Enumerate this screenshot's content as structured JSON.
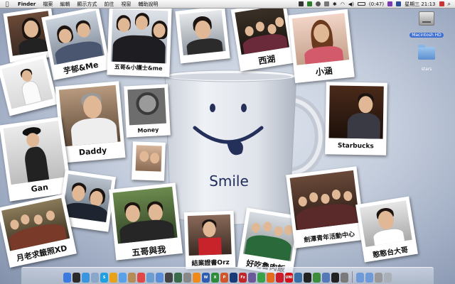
{
  "menubar": {
    "app": "Finder",
    "menus": [
      "檔案",
      "編輯",
      "顯示方式",
      "前往",
      "視窗",
      "輔助說明"
    ],
    "battery": "(0:47)",
    "clock": "星期三 21:13"
  },
  "desktop_icons": [
    {
      "label": "Macintosh HD",
      "icon": "hard-drive-icon"
    },
    {
      "label": "stars",
      "icon": "folder-icon"
    }
  ],
  "mug": {
    "label": "Smile"
  },
  "photos": [
    {
      "caption": ""
    },
    {
      "caption": "芋郁&Me"
    },
    {
      "caption": "五哥&小護士&me"
    },
    {
      "caption": ""
    },
    {
      "caption": "西湖"
    },
    {
      "caption": "小涵"
    },
    {
      "caption": ""
    },
    {
      "caption": "Daddy"
    },
    {
      "caption": "Money"
    },
    {
      "caption": "Starbucks"
    },
    {
      "caption": "Gan"
    },
    {
      "caption": ""
    },
    {
      "caption": ""
    },
    {
      "caption": "月老求籤照XD"
    },
    {
      "caption": "五哥與我"
    },
    {
      "caption": "結業證書Orz"
    },
    {
      "caption": "好吃魯肉飯"
    },
    {
      "caption": "劍潭青年活動中心"
    },
    {
      "caption": "憨憨台大哥"
    }
  ],
  "dock_items": [
    {
      "name": "finder",
      "color": "#3b7be0",
      "glyph": ""
    },
    {
      "name": "dashboard",
      "color": "#2b2b2b",
      "glyph": ""
    },
    {
      "name": "safari",
      "color": "#3a95e0",
      "glyph": ""
    },
    {
      "name": "mail",
      "color": "#8aa7c9",
      "glyph": ""
    },
    {
      "name": "skype",
      "color": "#1fa0e3",
      "glyph": "S"
    },
    {
      "name": "adium",
      "color": "#e8a21a",
      "glyph": ""
    },
    {
      "name": "ichat",
      "color": "#5aa0e8",
      "glyph": ""
    },
    {
      "name": "addressbook",
      "color": "#b58b58",
      "glyph": ""
    },
    {
      "name": "ical",
      "color": "#e04848",
      "glyph": ""
    },
    {
      "name": "preview",
      "color": "#6c9dd1",
      "glyph": ""
    },
    {
      "name": "itunes",
      "color": "#5a8fd8",
      "glyph": ""
    },
    {
      "name": "photobooth",
      "color": "#444",
      "glyph": ""
    },
    {
      "name": "timemachine",
      "color": "#3a6a4a",
      "glyph": ""
    },
    {
      "name": "sysprefs",
      "color": "#888",
      "glyph": ""
    },
    {
      "name": "vlc",
      "color": "#ef8a1b",
      "glyph": ""
    },
    {
      "name": "word",
      "color": "#2f5db3",
      "glyph": "W"
    },
    {
      "name": "excel",
      "color": "#2f8a3b",
      "glyph": "X"
    },
    {
      "name": "powerpoint",
      "color": "#d2562c",
      "glyph": "P"
    },
    {
      "name": "photoshop",
      "color": "#1a3a78",
      "glyph": ""
    },
    {
      "name": "filezilla",
      "color": "#c0262a",
      "glyph": "Fz"
    },
    {
      "name": "network",
      "color": "#6a5a9a",
      "glyph": ""
    },
    {
      "name": "chrome",
      "color": "#3aa14b",
      "glyph": ""
    },
    {
      "name": "firefox",
      "color": "#e56b1f",
      "glyph": ""
    },
    {
      "name": "opera",
      "color": "#cc1d2a",
      "glyph": ""
    },
    {
      "name": "uniqlo",
      "color": "#d0121b",
      "glyph": "UNI"
    },
    {
      "name": "activity",
      "color": "#3b6ea5",
      "glyph": ""
    },
    {
      "name": "terminal",
      "color": "#222",
      "glyph": ""
    },
    {
      "name": "app-green",
      "color": "#3c8d3c",
      "glyph": ""
    },
    {
      "name": "app-blue",
      "color": "#5578b8",
      "glyph": ""
    },
    {
      "name": "qq",
      "color": "#222",
      "glyph": ""
    },
    {
      "name": "app-gray",
      "color": "#7a7a7a",
      "glyph": ""
    },
    {
      "name": "downloads-folder",
      "color": "#6e9bd8",
      "glyph": ""
    },
    {
      "name": "documents-folder",
      "color": "#6e9bd8",
      "glyph": ""
    },
    {
      "name": "stack",
      "color": "#999",
      "glyph": ""
    },
    {
      "name": "trash",
      "color": "#aab0b8",
      "glyph": ""
    }
  ]
}
